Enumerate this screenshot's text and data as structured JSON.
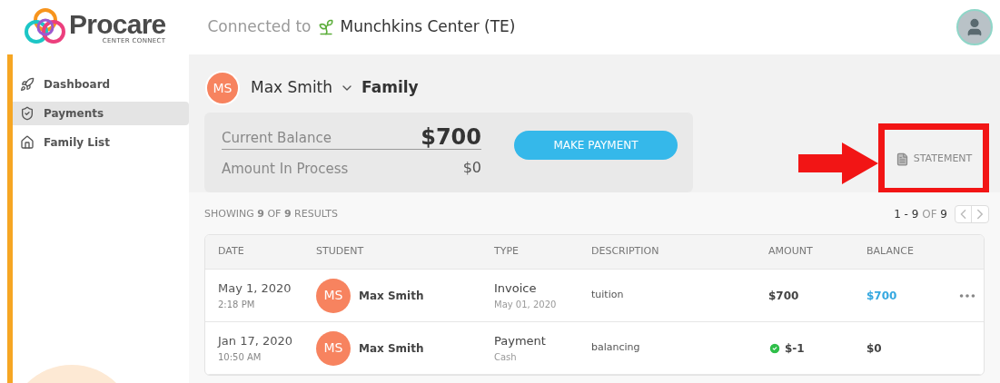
{
  "header": {
    "logo": {
      "name": "Procare",
      "tagline": "CENTER CONNECT"
    },
    "connected_label": "Connected to",
    "center_name": "Munchkins Center (TE)"
  },
  "sidebar": {
    "items": [
      {
        "label": "Dashboard",
        "selected": false
      },
      {
        "label": "Payments",
        "selected": true
      },
      {
        "label": "Family List",
        "selected": false
      }
    ]
  },
  "family": {
    "initials": "MS",
    "name": "Max Smith",
    "relation": "Family"
  },
  "balance": {
    "current_label": "Current Balance",
    "current_value": "$700",
    "process_label": "Amount In Process",
    "process_value": "$0",
    "pay_button": "MAKE PAYMENT"
  },
  "statement_button": "STATEMENT",
  "results": {
    "summary": "SHOWING **9** OF **9** RESULTS",
    "range": "**1 - 9** OF **9**"
  },
  "table": {
    "columns": [
      "DATE",
      "STUDENT",
      "TYPE",
      "DESCRIPTION",
      "AMOUNT",
      "BALANCE"
    ],
    "rows": [
      {
        "date": "May 1, 2020",
        "time": "2:18 PM",
        "initials": "MS",
        "student": "Max Smith",
        "type": "Invoice",
        "type_detail": "May 01, 2020",
        "description": "tuition",
        "amount": "$700",
        "amount_confirmed": false,
        "balance": "$700",
        "balance_highlight": true,
        "has_menu": true
      },
      {
        "date": "Jan 17, 2020",
        "time": "10:50 AM",
        "initials": "MS",
        "student": "Max Smith",
        "type": "Payment",
        "type_detail": "Cash",
        "description": "balancing",
        "amount": "$-1",
        "amount_confirmed": true,
        "balance": "$0",
        "balance_highlight": false,
        "has_menu": false
      }
    ]
  }
}
